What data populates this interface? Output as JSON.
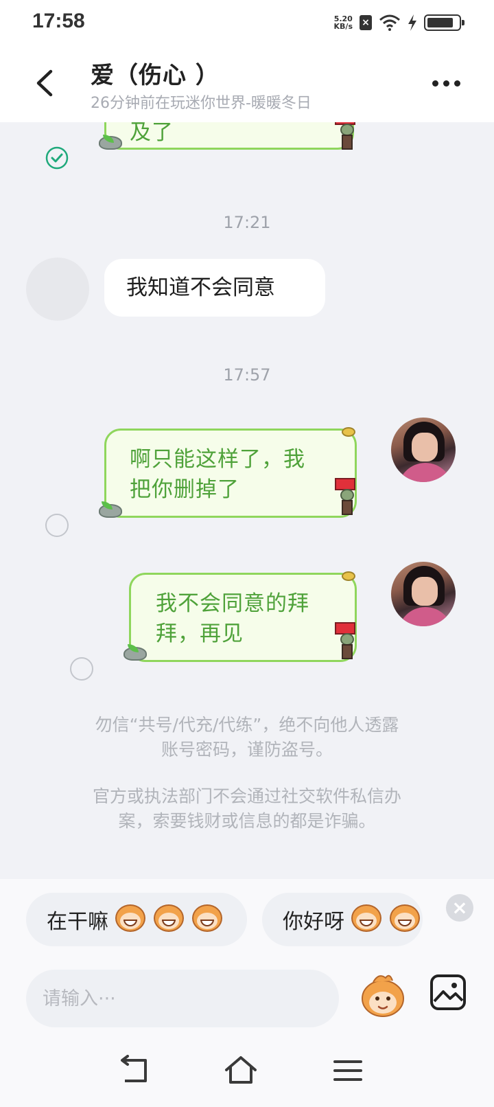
{
  "status_bar": {
    "time": "17:58",
    "net_speed_value": "5.20",
    "net_speed_unit": "KB/s",
    "battery_level": 0.85
  },
  "header": {
    "title": "爱（伤心 ）",
    "subtitle": "26分钟前在玩迷你世界-暖暖冬日"
  },
  "messages": [
    {
      "id": "m0",
      "direction": "outgoing",
      "text": "及了",
      "status": "read"
    },
    {
      "id": "t1",
      "type": "timestamp",
      "text": "17:21"
    },
    {
      "id": "m1",
      "direction": "incoming",
      "text": "我知道不会同意"
    },
    {
      "id": "t2",
      "type": "timestamp",
      "text": "17:57"
    },
    {
      "id": "m2",
      "direction": "outgoing",
      "line1": "啊只能这样了，我",
      "line2": "把你删掉了",
      "status": "unread"
    },
    {
      "id": "m3",
      "direction": "outgoing",
      "line1": "我不会同意的拜",
      "line2": "拜，再见",
      "status": "unread"
    }
  ],
  "safety_notice": {
    "line1": "勿信“共号/代充/代练”，绝不向他人透露",
    "line2": "账号密码，谨防盗号。",
    "line3": "官方或执法部门不会通过社交软件私信办",
    "line4": "案，索要钱财或信息的都是诈骗。"
  },
  "quick_replies": [
    {
      "label": "在干嘛"
    },
    {
      "label": "你好呀"
    }
  ],
  "input": {
    "placeholder": "请输入···"
  },
  "icons": {
    "back": "back-arrow-icon",
    "more": "more-dots-icon",
    "read": "read-check-icon",
    "emoji": "monkey-emoji-icon",
    "image": "image-icon",
    "nav_back": "nav-back-icon",
    "nav_home": "nav-home-icon",
    "nav_menu": "nav-menu-icon"
  },
  "colors": {
    "bubble_border": "#8fd65c",
    "bubble_bg": "#f6fdea",
    "bubble_text": "#4fa23a",
    "read_check": "#1fa97b",
    "background": "#f1f2f6"
  }
}
